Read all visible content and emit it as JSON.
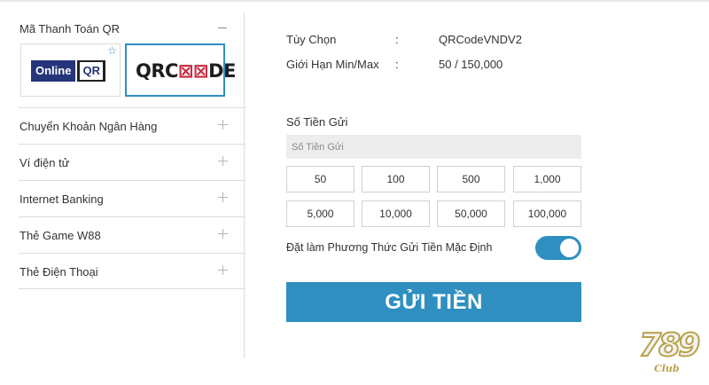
{
  "sidebar": {
    "title": "Mã Thanh Toán QR",
    "qr_options": [
      {
        "name": "Online",
        "suffix": "QR"
      },
      {
        "name_left": "QRC",
        "name_mark": "⊠⊠",
        "name_right": "DE"
      }
    ],
    "items": [
      {
        "label": "Chuyển Khoản Ngân Hàng"
      },
      {
        "label": "Ví điện tử"
      },
      {
        "label": "Internet Banking"
      },
      {
        "label": "Thẻ Game W88"
      },
      {
        "label": "Thẻ Điện Thoại"
      }
    ]
  },
  "main": {
    "option_label": "Tùy Chọn",
    "option_value": "QRCodeVNDV2",
    "limit_label": "Giới Hạn Min/Max",
    "limit_value": "50 / 150,000",
    "separator": ":",
    "amount_label": "Số Tiền Gửi",
    "amount_placeholder": "Số Tiền Gửi",
    "amount_buttons": [
      "50",
      "100",
      "500",
      "1,000",
      "5,000",
      "10,000",
      "50,000",
      "100,000"
    ],
    "default_method_label": "Đặt làm Phương Thức Gửi Tiền Mặc Định",
    "default_method_on": true,
    "submit_label": "GỬI TIỀN"
  },
  "brand": {
    "digits": "789",
    "club": "Club"
  },
  "colors": {
    "accent": "#2e8fc0",
    "online_navy": "#26357a",
    "qrcode_mark": "#c7283d"
  }
}
